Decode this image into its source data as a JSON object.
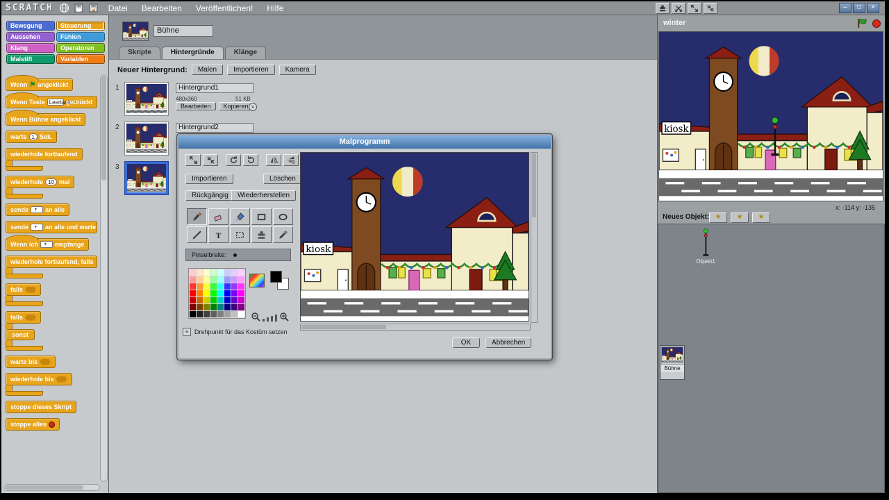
{
  "menu": {
    "logo": "SCRATCH",
    "items": [
      "Datei",
      "Bearbeiten",
      "Veröffentlichen!",
      "Hilfe"
    ],
    "toolbar_icons": [
      "duplicate",
      "scissors",
      "grow",
      "shrink"
    ],
    "window_buttons": [
      "minimize",
      "maximize",
      "close"
    ]
  },
  "categories": [
    {
      "label": "Bewegung",
      "color": "#4a6bd4"
    },
    {
      "label": "Steuerung",
      "color": "#e8a41a",
      "selected": true
    },
    {
      "label": "Aussehen",
      "color": "#9460d1"
    },
    {
      "label": "Fühlen",
      "color": "#3d9bdc"
    },
    {
      "label": "Klang",
      "color": "#cf5fc4"
    },
    {
      "label": "Operatoren",
      "color": "#7fbf1f"
    },
    {
      "label": "Malstift",
      "color": "#0e9a6c"
    },
    {
      "label": "Variablen",
      "color": "#ee7d16"
    }
  ],
  "palette_blocks": [
    {
      "shape": "hat",
      "parts": [
        {
          "text": "Wenn"
        },
        {
          "icon": "flag"
        },
        {
          "text": "angeklickt"
        }
      ]
    },
    {
      "shape": "hat",
      "parts": [
        {
          "text": "Wenn Taste"
        },
        {
          "dropdown": "Leertaste"
        },
        {
          "text": "gedrückt"
        }
      ]
    },
    {
      "shape": "hat",
      "parts": [
        {
          "text": "Wenn Bühne angeklickt"
        }
      ]
    },
    {
      "shape": "stack",
      "parts": [
        {
          "text": "warte"
        },
        {
          "num": "1"
        },
        {
          "text": "Sek."
        }
      ]
    },
    {
      "shape": "c",
      "parts": [
        {
          "text": "wiederhole fortlaufend"
        }
      ]
    },
    {
      "shape": "c",
      "parts": [
        {
          "text": "wiederhole"
        },
        {
          "num": "10"
        },
        {
          "text": "mal"
        }
      ]
    },
    {
      "shape": "stack",
      "parts": [
        {
          "text": "sende"
        },
        {
          "dropdown": ""
        },
        {
          "text": "an alle"
        }
      ]
    },
    {
      "shape": "stack",
      "parts": [
        {
          "text": "sende"
        },
        {
          "dropdown": ""
        },
        {
          "text": "an alle und warte"
        }
      ]
    },
    {
      "shape": "hat",
      "parts": [
        {
          "text": "Wenn ich"
        },
        {
          "dropdown": ""
        },
        {
          "text": "empfange"
        }
      ]
    },
    {
      "shape": "c",
      "parts": [
        {
          "text": "wiederhole fortlaufend, falls"
        },
        {
          "hex": true
        }
      ]
    },
    {
      "shape": "c",
      "parts": [
        {
          "text": "falls"
        },
        {
          "hex": true
        }
      ]
    },
    {
      "shape": "cc",
      "else_label": "sonst",
      "parts": [
        {
          "text": "falls"
        },
        {
          "hex": true
        }
      ]
    },
    {
      "shape": "stack",
      "parts": [
        {
          "text": "warte bis"
        },
        {
          "hex": true
        }
      ]
    },
    {
      "shape": "c",
      "parts": [
        {
          "text": "wiederhole bis"
        },
        {
          "hex": true
        }
      ]
    },
    {
      "shape": "cap",
      "parts": [
        {
          "text": "stoppe dieses Skript"
        }
      ]
    },
    {
      "shape": "cap",
      "parts": [
        {
          "text": "stoppe alles"
        },
        {
          "icon": "stop"
        }
      ]
    }
  ],
  "center": {
    "sprite_name": "Bühne",
    "tabs": [
      {
        "label": "Skripte",
        "active": false
      },
      {
        "label": "Hintergründe",
        "active": true
      },
      {
        "label": "Klänge",
        "active": false
      }
    ],
    "new_background_label": "Neuer Hintergrund:",
    "new_background_buttons": [
      "Malen",
      "Importieren",
      "Kamera"
    ],
    "backgrounds": [
      {
        "index": "1",
        "name": "Hintergrund1",
        "dimensions": "480x360",
        "filesize": "51 KB",
        "edit_label": "Bearbeiten",
        "copy_label": "Kopieren",
        "selected": false
      },
      {
        "index": "2",
        "name": "Hintergrund2",
        "selected": false
      },
      {
        "index": "3",
        "selected": true
      }
    ]
  },
  "dialog": {
    "title": "Malprogramm",
    "buttons": {
      "import": "Importieren",
      "clear": "Löschen",
      "undo": "Rückgängig",
      "redo": "Wiederherstellen",
      "ok": "OK",
      "cancel": "Abbrechen"
    },
    "brush_label": "Pinselbreite:",
    "rotation_label": "Drehpunkt für das Kostüm setzen",
    "transform_buttons": [
      "grow",
      "shrink",
      "rotate-cw",
      "rotate-ccw",
      "flip-horizontal",
      "flip-vertical"
    ],
    "tools": [
      "brush",
      "eraser",
      "fill",
      "rectangle",
      "ellipse",
      "line",
      "text",
      "select",
      "stamp",
      "eyedropper"
    ],
    "palette": [
      "#ffcccc",
      "#ffe5cc",
      "#ffffcc",
      "#ccffcc",
      "#ccffff",
      "#ccccff",
      "#e5ccff",
      "#ffccff",
      "#ff9999",
      "#ffcc99",
      "#ffff99",
      "#99ff99",
      "#99ffff",
      "#9999ff",
      "#cc99ff",
      "#ff99ff",
      "#ff3333",
      "#ff9933",
      "#ffff33",
      "#33ff33",
      "#33ffff",
      "#3333ff",
      "#9933ff",
      "#ff33ff",
      "#ff0000",
      "#ff8000",
      "#ffff00",
      "#00ff00",
      "#00ffff",
      "#0000ff",
      "#8000ff",
      "#ff00ff",
      "#cc0000",
      "#cc6600",
      "#cccc00",
      "#00cc00",
      "#00cccc",
      "#0000cc",
      "#6600cc",
      "#cc00cc",
      "#800000",
      "#804000",
      "#808000",
      "#008000",
      "#008080",
      "#000080",
      "#400080",
      "#800080",
      "#000000",
      "#202020",
      "#404040",
      "#606060",
      "#808080",
      "#a0a0a0",
      "#c0c0c0",
      "#ffffff"
    ]
  },
  "stage": {
    "project_name": "winter",
    "coords": "x: -114 y: -135",
    "new_sprite_label": "Neues Objekt:",
    "scene_kiosk_label": "kiosk"
  },
  "sprites": {
    "stage_button_label": "Bühne",
    "items": [
      {
        "name": "Objekt1"
      }
    ]
  }
}
